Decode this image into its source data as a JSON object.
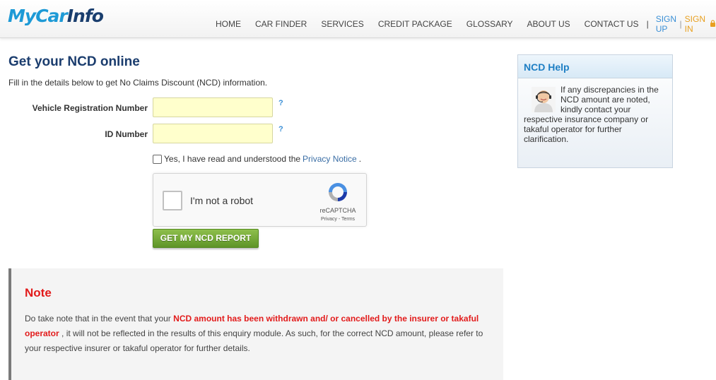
{
  "header": {
    "logo": {
      "my": "My",
      "car": "Car",
      "info": "Info"
    },
    "nav": [
      "HOME",
      "CAR FINDER",
      "SERVICES",
      "CREDIT PACKAGE",
      "GLOSSARY",
      "ABOUT US",
      "CONTACT US"
    ],
    "separator": "|",
    "sign_up": "SIGN UP",
    "divider": "|",
    "sign_in": "SIGN IN",
    "lock_icon": "lock-icon"
  },
  "main": {
    "title": "Get your NCD online",
    "intro": "Fill in the details below to get No Claims Discount (NCD) information.",
    "fields": [
      {
        "label": "Vehicle Registration Number",
        "value": "",
        "help": "?"
      },
      {
        "label": "ID Number",
        "value": "",
        "help": "?"
      }
    ],
    "consent": {
      "text": "Yes, I have read and understood the",
      "link": "Privacy Notice",
      "end": "."
    },
    "captcha": {
      "label": "I'm not a robot",
      "brand": "reCAPTCHA",
      "links": "Privacy - Terms"
    },
    "submit_label": "GET MY NCD REPORT"
  },
  "note": {
    "title": "Note",
    "text_before": "Do take note that in the event that your",
    "highlight": "NCD amount has been withdrawn and/ or cancelled by the insurer or takaful operator",
    "text_after": ", it will not be reflected in the results of this enquiry module. As such, for the correct NCD amount, please refer to your respective insurer or takaful operator for further details."
  },
  "sidebar": {
    "title": "NCD Help",
    "text": "If any discrepancies in the NCD amount are noted, kindly contact your respective insurance company or takaful operator for further clarification."
  },
  "colors": {
    "brand_blue": "#1e9ad6",
    "title_navy": "#1b3d6e",
    "alert_red": "#e21b1b",
    "button_green": "#6ea333",
    "field_yellow": "#ffffcc"
  }
}
